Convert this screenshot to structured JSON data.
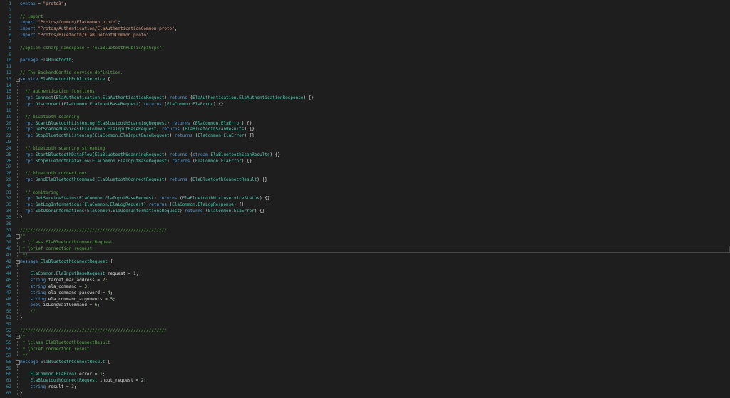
{
  "current_line": 40,
  "fold_lines": [
    13,
    38,
    42,
    54,
    58
  ],
  "lines": [
    [
      [
        "kw",
        "syntax"
      ],
      [
        "id",
        " = "
      ],
      [
        "st",
        "\"proto3\""
      ],
      [
        "id",
        ";"
      ]
    ],
    [],
    [
      [
        "cm",
        "// import"
      ]
    ],
    [
      [
        "kw",
        "import"
      ],
      [
        "id",
        " "
      ],
      [
        "st",
        "\"Protos/Common/ElaCommon.proto\""
      ],
      [
        "id",
        ";"
      ]
    ],
    [
      [
        "kw",
        "import"
      ],
      [
        "id",
        " "
      ],
      [
        "st",
        "\"Protos/Authentication/ElaAuthenticationCommon.proto\""
      ],
      [
        "id",
        ";"
      ]
    ],
    [
      [
        "kw",
        "import"
      ],
      [
        "id",
        " "
      ],
      [
        "st",
        "\"Protos/Bluetooth/ElaBluetoothCommon.proto\""
      ],
      [
        "id",
        ";"
      ]
    ],
    [],
    [
      [
        "cm",
        "//option csharp_namespace = \"elaBluetoothPublicApiGrpc\";"
      ]
    ],
    [],
    [
      [
        "kw",
        "package"
      ],
      [
        "id",
        " "
      ],
      [
        "ty",
        "ElaBluetooth"
      ],
      [
        "id",
        ";"
      ]
    ],
    [],
    [
      [
        "cm",
        "// The BackendConfig service definition."
      ]
    ],
    [
      [
        "kw",
        "service"
      ],
      [
        "id",
        " "
      ],
      [
        "ty",
        "ElaBluetoothPublicService"
      ],
      [
        "id",
        " {"
      ]
    ],
    [],
    [
      [
        "cm",
        "  // authentication functions"
      ]
    ],
    [
      [
        "kw",
        "  rpc "
      ],
      [
        "ty",
        "Connect"
      ],
      [
        "id",
        "("
      ],
      [
        "ty",
        "ElaAuthentication.ElaAuthenticationRequest"
      ],
      [
        "id",
        ") "
      ],
      [
        "kw",
        "returns"
      ],
      [
        "id",
        " ("
      ],
      [
        "ty",
        "ElaAuthentication.ElaAuthenticationResponse"
      ],
      [
        "id",
        ") {}"
      ]
    ],
    [
      [
        "kw",
        "  rpc "
      ],
      [
        "ty",
        "Disconnect"
      ],
      [
        "id",
        "("
      ],
      [
        "ty",
        "ElaCommon.ElaInputBaseRequest"
      ],
      [
        "id",
        ") "
      ],
      [
        "kw",
        "returns"
      ],
      [
        "id",
        " ("
      ],
      [
        "ty",
        "ElaCommon.ElaError"
      ],
      [
        "id",
        ") {}"
      ]
    ],
    [],
    [
      [
        "cm",
        "  // bluetooth scanning"
      ]
    ],
    [
      [
        "kw",
        "  rpc "
      ],
      [
        "ty",
        "StartBluetoothListening"
      ],
      [
        "id",
        "("
      ],
      [
        "ty",
        "ElaBluetoothScanningRequest"
      ],
      [
        "id",
        ") "
      ],
      [
        "kw",
        "returns"
      ],
      [
        "id",
        " ("
      ],
      [
        "ty",
        "ElaCommon.ElaError"
      ],
      [
        "id",
        ") {}"
      ]
    ],
    [
      [
        "kw",
        "  rpc "
      ],
      [
        "ty",
        "GetScannedDevices"
      ],
      [
        "id",
        "("
      ],
      [
        "ty",
        "ElaCommon.ElaInputBaseRequest"
      ],
      [
        "id",
        ") "
      ],
      [
        "kw",
        "returns"
      ],
      [
        "id",
        " ("
      ],
      [
        "ty",
        "ElaBluetoothScanResults"
      ],
      [
        "id",
        ") {}"
      ]
    ],
    [
      [
        "kw",
        "  rpc "
      ],
      [
        "ty",
        "StopBluetoothListening"
      ],
      [
        "id",
        "("
      ],
      [
        "ty",
        "ElaCommon.ElaInputBaseRequest"
      ],
      [
        "id",
        ") "
      ],
      [
        "kw",
        "returns"
      ],
      [
        "id",
        " ("
      ],
      [
        "ty",
        "ElaCommon.ElaError"
      ],
      [
        "id",
        ") {}"
      ]
    ],
    [],
    [
      [
        "cm",
        "  // bluetooth scanning streaming"
      ]
    ],
    [
      [
        "kw",
        "  rpc "
      ],
      [
        "ty",
        "StartBluetoothDataFlow"
      ],
      [
        "id",
        "("
      ],
      [
        "ty",
        "ElaBluetoothScanningRequest"
      ],
      [
        "id",
        ") "
      ],
      [
        "kw",
        "returns"
      ],
      [
        "id",
        " ("
      ],
      [
        "kw",
        "stream"
      ],
      [
        "id",
        " "
      ],
      [
        "ty",
        "ElaBluetoothScanResults"
      ],
      [
        "id",
        ") {}"
      ]
    ],
    [
      [
        "kw",
        "  rpc "
      ],
      [
        "ty",
        "StopBluetoothDataFlow"
      ],
      [
        "id",
        "("
      ],
      [
        "ty",
        "ElaCommon.ElaInputBaseRequest"
      ],
      [
        "id",
        ") "
      ],
      [
        "kw",
        "returns"
      ],
      [
        "id",
        " ("
      ],
      [
        "ty",
        "ElaCommon.ElaError"
      ],
      [
        "id",
        ") {}"
      ]
    ],
    [],
    [
      [
        "cm",
        "  // bluetooth connections"
      ]
    ],
    [
      [
        "kw",
        "  rpc "
      ],
      [
        "ty",
        "SendElaBluetoothCommand"
      ],
      [
        "id",
        "("
      ],
      [
        "ty",
        "ElaBluetoothConnectRequest"
      ],
      [
        "id",
        ") "
      ],
      [
        "kw",
        "returns"
      ],
      [
        "id",
        " ("
      ],
      [
        "ty",
        "ElaBluetoothConnectResult"
      ],
      [
        "id",
        ") {}"
      ]
    ],
    [],
    [
      [
        "cm",
        "  // monitoring"
      ]
    ],
    [
      [
        "kw",
        "  rpc "
      ],
      [
        "ty",
        "GetServiceStatus"
      ],
      [
        "id",
        "("
      ],
      [
        "ty",
        "ElaCommon.ElaInputBaseRequest"
      ],
      [
        "id",
        ") "
      ],
      [
        "kw",
        "returns"
      ],
      [
        "id",
        " ("
      ],
      [
        "ty",
        "ElaBluetoothMicroserviceStatus"
      ],
      [
        "id",
        ") {}"
      ]
    ],
    [
      [
        "kw",
        "  rpc "
      ],
      [
        "ty",
        "GetLogInformations"
      ],
      [
        "id",
        "("
      ],
      [
        "ty",
        "ElaCommon.ElaLogRequest"
      ],
      [
        "id",
        ") "
      ],
      [
        "kw",
        "returns"
      ],
      [
        "id",
        " ("
      ],
      [
        "ty",
        "ElaCommon.ElaLogResponse"
      ],
      [
        "id",
        ") {}"
      ]
    ],
    [
      [
        "kw",
        "  rpc "
      ],
      [
        "ty",
        "SetUserInformations"
      ],
      [
        "id",
        "("
      ],
      [
        "ty",
        "ElaCommon.ElaUserInformationsRequest"
      ],
      [
        "id",
        ") "
      ],
      [
        "kw",
        "returns"
      ],
      [
        "id",
        " ("
      ],
      [
        "ty",
        "ElaCommon.ElaError"
      ],
      [
        "id",
        ") {}"
      ]
    ],
    [
      [
        "id",
        "}"
      ]
    ],
    [],
    [
      [
        "cm",
        "/////////////////////////////////////////////////////////"
      ]
    ],
    [
      [
        "cm",
        "/*"
      ]
    ],
    [
      [
        "cm",
        " * \\class ElaBluetoothConnectRequest"
      ]
    ],
    [
      [
        "cm",
        " * \\brief connection request "
      ]
    ],
    [
      [
        "cm",
        " */"
      ]
    ],
    [
      [
        "kw",
        "message"
      ],
      [
        "id",
        " "
      ],
      [
        "ty",
        "ElaBluetoothConnectRequest"
      ],
      [
        "id",
        " {"
      ]
    ],
    [],
    [
      [
        "ty",
        "    ElaCommon.ElaInputBaseRequest"
      ],
      [
        "id",
        " request = "
      ],
      [
        "nm",
        "1"
      ],
      [
        "id",
        ";"
      ]
    ],
    [
      [
        "kw",
        "    string"
      ],
      [
        "id",
        " target_mac_address = "
      ],
      [
        "nm",
        "2"
      ],
      [
        "id",
        ";"
      ]
    ],
    [
      [
        "kw",
        "    string"
      ],
      [
        "id",
        " ela_command = "
      ],
      [
        "nm",
        "3"
      ],
      [
        "id",
        ";"
      ]
    ],
    [
      [
        "kw",
        "    string"
      ],
      [
        "id",
        " ela_command_password = "
      ],
      [
        "nm",
        "4"
      ],
      [
        "id",
        ";"
      ]
    ],
    [
      [
        "kw",
        "    string"
      ],
      [
        "id",
        " ela_command_arguments = "
      ],
      [
        "nm",
        "5"
      ],
      [
        "id",
        ";"
      ]
    ],
    [
      [
        "kw",
        "    bool"
      ],
      [
        "id",
        " isLongWaitCommand = "
      ],
      [
        "nm",
        "6"
      ],
      [
        "id",
        ";"
      ]
    ],
    [
      [
        "cm",
        "    //"
      ]
    ],
    [
      [
        "id",
        "}"
      ]
    ],
    [],
    [
      [
        "cm",
        "/////////////////////////////////////////////////////////"
      ]
    ],
    [
      [
        "cm",
        "/*"
      ]
    ],
    [
      [
        "cm",
        " * \\class ElaBluetoothConnectResult"
      ]
    ],
    [
      [
        "cm",
        " * \\brief connection result"
      ]
    ],
    [
      [
        "cm",
        " */"
      ]
    ],
    [
      [
        "kw",
        "message"
      ],
      [
        "id",
        " "
      ],
      [
        "ty",
        "ElaBluetoothConnectResult"
      ],
      [
        "id",
        " {"
      ]
    ],
    [],
    [
      [
        "ty",
        "    ElaCommon.ElaError"
      ],
      [
        "id",
        " error = "
      ],
      [
        "nm",
        "1"
      ],
      [
        "id",
        ";"
      ]
    ],
    [
      [
        "ty",
        "    ElaBluetoothConnectRequest"
      ],
      [
        "id",
        " input_request = "
      ],
      [
        "nm",
        "2"
      ],
      [
        "id",
        ";"
      ]
    ],
    [
      [
        "kw",
        "    string"
      ],
      [
        "id",
        " result = "
      ],
      [
        "nm",
        "3"
      ],
      [
        "id",
        ";"
      ]
    ],
    [
      [
        "id",
        "}"
      ]
    ]
  ]
}
